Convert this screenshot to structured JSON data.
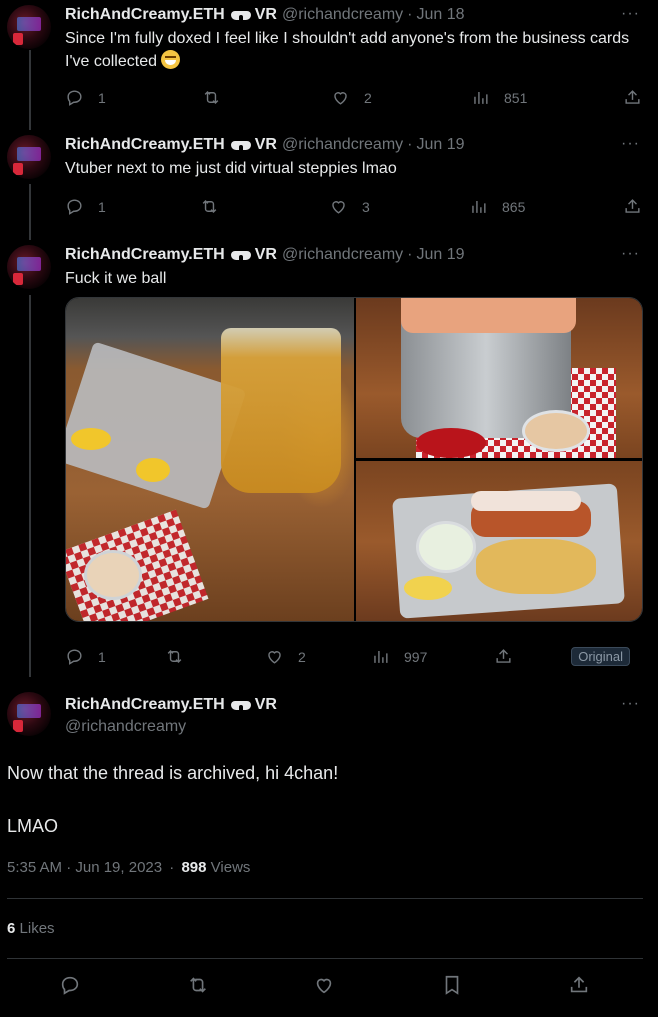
{
  "tweets": [
    {
      "name": "RichAndCreamy.ETH",
      "vr": "VR",
      "handle": "@richandcreamy",
      "dot": "·",
      "date": "Jun 18",
      "text": "Since I'm fully doxed I feel like I shouldn't add anyone's from the business cards I've collected",
      "emoji": "sweat-smile-emoji",
      "replies": "1",
      "retweets": "",
      "likes": "2",
      "views": "851"
    },
    {
      "name": "RichAndCreamy.ETH",
      "vr": "VR",
      "handle": "@richandcreamy",
      "dot": "·",
      "date": "Jun 19",
      "text": "Vtuber next to me just did virtual steppies lmao",
      "replies": "1",
      "retweets": "",
      "likes": "3",
      "views": "865"
    },
    {
      "name": "RichAndCreamy.ETH",
      "vr": "VR",
      "handle": "@richandcreamy",
      "dot": "·",
      "date": "Jun 19",
      "text": "Fuck it we ball",
      "replies": "1",
      "retweets": "",
      "likes": "2",
      "views": "997",
      "badge": "Original"
    }
  ],
  "main": {
    "name": "RichAndCreamy.ETH",
    "vr": "VR",
    "handle": "@richandcreamy",
    "line1": "Now that the thread is archived, hi 4chan!",
    "line2": "LMAO",
    "time": "5:35 AM · Jun 19, 2023",
    "dot": "·",
    "views_count": "898",
    "views_label": "Views",
    "likes_count": "6",
    "likes_label": "Likes"
  },
  "more": "···"
}
